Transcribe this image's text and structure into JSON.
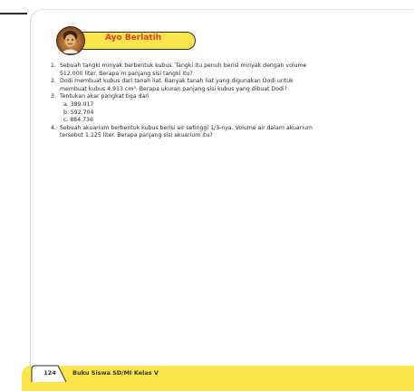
{
  "header": {
    "title": "Ayo Berlatih"
  },
  "exercises": [
    {
      "number": "1.",
      "text": "Sebuah tangki minyak berbentuk kubus. Tangki itu penuh berisi minyak dengan volume 512.000 liter. Berapa m panjang sisi tangki itu?"
    },
    {
      "number": "2.",
      "text": "Dodi membuat kubus dari tanah liat. Banyak tanah liat yang digunakan Dodi untuk membuat kubus 4.913 cm³. Berapa ukuran panjang sisi kubus yang dibuat Dodi?"
    },
    {
      "number": "3.",
      "text": "Tentukan akar pangkat tiga dari",
      "options": [
        "a. 389.017",
        "b. 592.704",
        "c. 884.736"
      ]
    },
    {
      "number": "4.",
      "text": "Sebuah akuarium berbentuk kubus berisi air setinggi 1/3-nya. Volume air dalam akuarium tersebut 1.125 liter. Berapa panjang sisi akuarium itu?"
    }
  ],
  "footer": {
    "page_number": "124",
    "caption": "Buku Siswa SD/MI Kelas V"
  },
  "colors": {
    "accent_yellow": "#fbe54a",
    "title_red": "#e23b2d"
  },
  "icons": {
    "header_avatar": "student-photo-icon"
  }
}
